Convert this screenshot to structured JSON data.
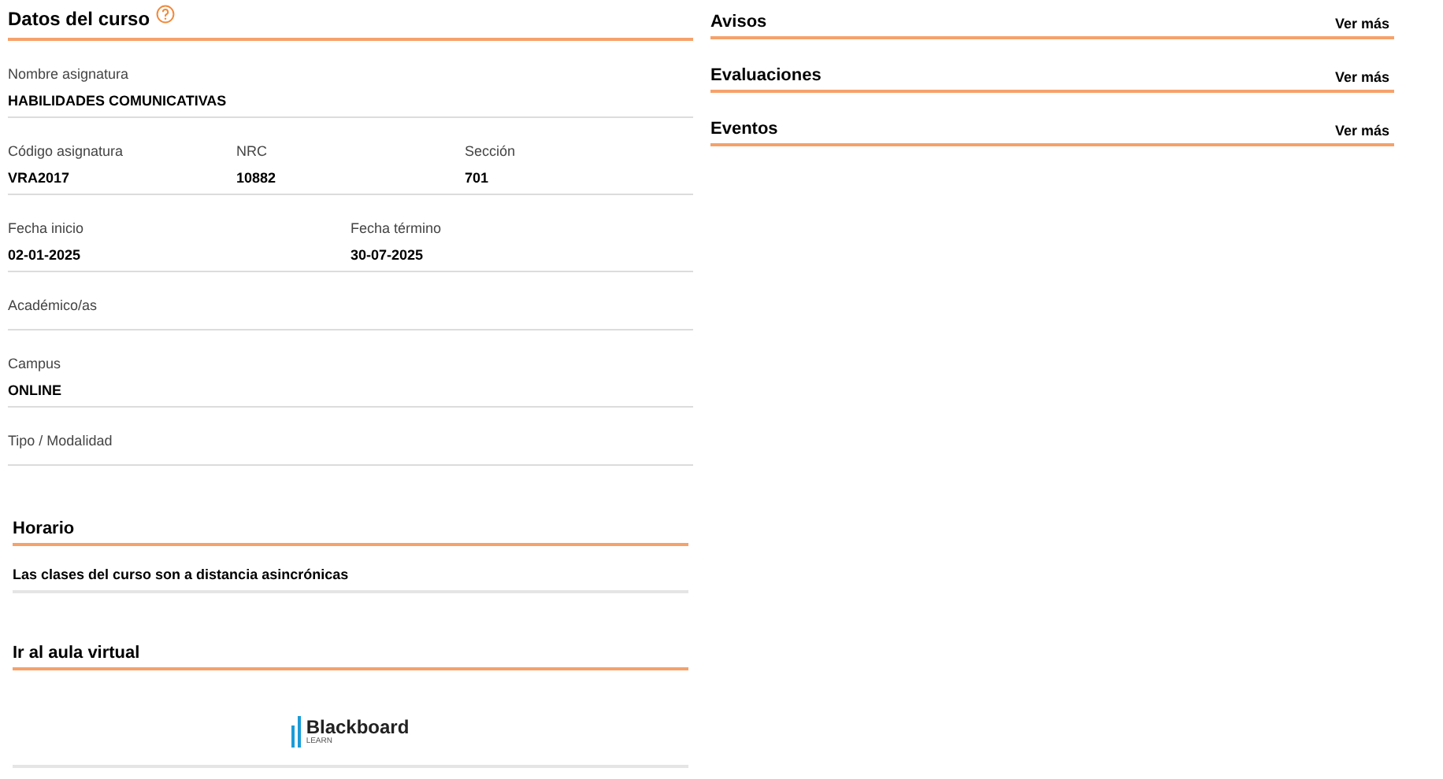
{
  "course_info": {
    "title": "Datos del curso",
    "rows": [
      {
        "fields": [
          {
            "label": "Nombre asignatura",
            "value": "HABILIDADES COMUNICATIVAS"
          }
        ]
      },
      {
        "fields": [
          {
            "label": "Código asignatura",
            "value": "VRA2017"
          },
          {
            "label": "NRC",
            "value": "10882"
          },
          {
            "label": "Sección",
            "value": "701"
          }
        ]
      },
      {
        "fields": [
          {
            "label": "Fecha inicio",
            "value": "02-01-2025"
          },
          {
            "label": "Fecha término",
            "value": "30-07-2025"
          }
        ]
      },
      {
        "fields": [
          {
            "label": "Académico/as"
          }
        ]
      },
      {
        "fields": [
          {
            "label": "Campus",
            "value": "ONLINE"
          }
        ]
      },
      {
        "fields": [
          {
            "label": "Tipo / Modalidad"
          }
        ]
      }
    ]
  },
  "schedule": {
    "title": "Horario",
    "text": "Las clases del curso son a distancia asincrónicas"
  },
  "virtual_classroom": {
    "title": "Ir al aula virtual",
    "logo": {
      "name": "Blackboard",
      "subtitle": "LEARN"
    }
  },
  "panels": [
    {
      "title": "Avisos",
      "link": "Ver más"
    },
    {
      "title": "Evaluaciones",
      "link": "Ver más"
    },
    {
      "title": "Eventos",
      "link": "Ver más"
    }
  ]
}
